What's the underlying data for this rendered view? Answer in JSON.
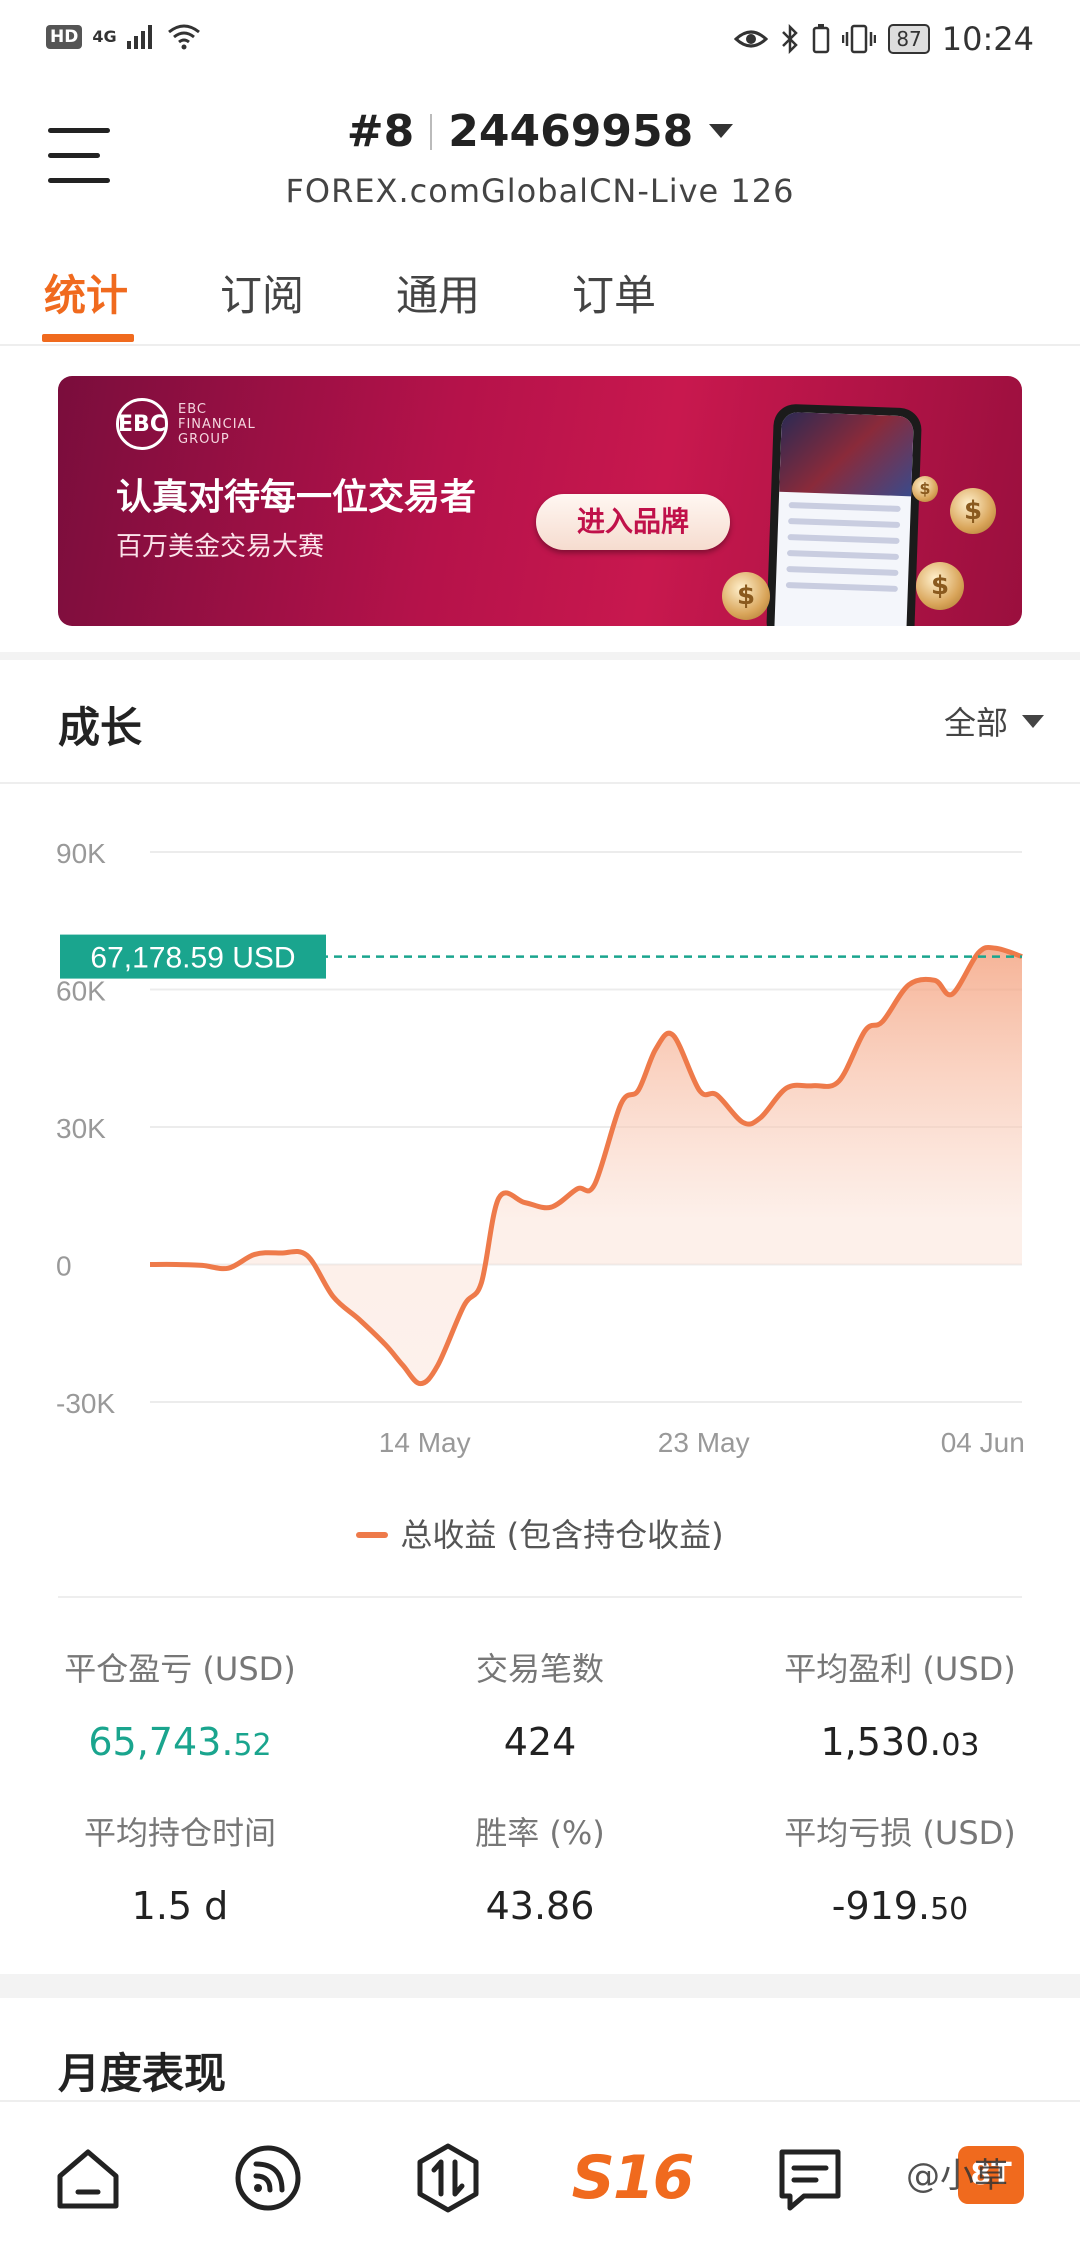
{
  "status_bar": {
    "hd": "HD",
    "network": "4G",
    "battery": "87",
    "time": "10:24"
  },
  "header": {
    "account_index": "#8",
    "account_number": "24469958",
    "server": "FOREX.comGlobalCN-Live 126"
  },
  "tabs": [
    "统计",
    "订阅",
    "通用",
    "订单"
  ],
  "banner": {
    "logo_text": "EBC",
    "logo_line1": "EBC",
    "logo_line2": "FINANCIAL",
    "logo_line3": "GROUP",
    "title": "认真对待每一位交易者",
    "subtitle": "百万美金交易大赛",
    "button": "进入品牌"
  },
  "growth": {
    "title": "成长",
    "filter": "全部",
    "current_value_label": "67,178.59 USD",
    "legend": "总收益 (包含持仓收益)"
  },
  "chart_data": {
    "type": "area",
    "title": "",
    "ylabel": "",
    "y_ticks": [
      "90K",
      "60K",
      "30K",
      "0",
      "-30K"
    ],
    "y_tick_values": [
      90000,
      60000,
      30000,
      0,
      -30000
    ],
    "ylim": [
      -30000,
      90000
    ],
    "x_tick_labels": [
      "14 May",
      "23 May",
      "04 Jun"
    ],
    "grid": true,
    "series": [
      {
        "name": "总收益 (包含持仓收益)",
        "color": "#ee7a4a",
        "points": [
          [
            0,
            0
          ],
          [
            0.03,
            0
          ],
          [
            0.06,
            -200
          ],
          [
            0.09,
            -800
          ],
          [
            0.12,
            2200
          ],
          [
            0.15,
            2500
          ],
          [
            0.18,
            2000
          ],
          [
            0.21,
            -7000
          ],
          [
            0.24,
            -12000
          ],
          [
            0.27,
            -17500
          ],
          [
            0.29,
            -22000
          ],
          [
            0.31,
            -26000
          ],
          [
            0.33,
            -22000
          ],
          [
            0.36,
            -9000
          ],
          [
            0.38,
            -4000
          ],
          [
            0.4,
            14500
          ],
          [
            0.43,
            13500
          ],
          [
            0.46,
            12500
          ],
          [
            0.49,
            16500
          ],
          [
            0.51,
            17500
          ],
          [
            0.54,
            35000
          ],
          [
            0.56,
            38000
          ],
          [
            0.58,
            47000
          ],
          [
            0.6,
            50000
          ],
          [
            0.63,
            38000
          ],
          [
            0.65,
            37000
          ],
          [
            0.68,
            31000
          ],
          [
            0.7,
            32000
          ],
          [
            0.73,
            38500
          ],
          [
            0.76,
            39000
          ],
          [
            0.79,
            40000
          ],
          [
            0.82,
            51000
          ],
          [
            0.84,
            53000
          ],
          [
            0.87,
            61000
          ],
          [
            0.9,
            62000
          ],
          [
            0.92,
            59000
          ],
          [
            0.95,
            68000
          ],
          [
            0.97,
            69000
          ],
          [
            1.0,
            67178.59
          ]
        ]
      }
    ],
    "reference_line": {
      "value": 67178.59,
      "label": "67,178.59 USD",
      "color": "#1aa58e"
    }
  },
  "stats": [
    {
      "label": "平仓盈亏 (USD)",
      "int": "65,743.",
      "frac": "52",
      "color": "green"
    },
    {
      "label": "交易笔数",
      "int": "424",
      "frac": "",
      "color": "default"
    },
    {
      "label": "平均盈利 (USD)",
      "int": "1,530.",
      "frac": "03",
      "color": "default"
    },
    {
      "label": "平均持仓时间",
      "int": "1.5 d",
      "frac": "",
      "color": "default"
    },
    {
      "label": "胜率 (%)",
      "int": "43.86",
      "frac": "",
      "color": "default"
    },
    {
      "label": "平均亏损 (USD)",
      "int": "-919.",
      "frac": "50",
      "color": "default"
    }
  ],
  "monthly": {
    "title": "月度表现"
  },
  "bottom_nav": {
    "s16_label": "S16",
    "badge": "8T",
    "watermark": "@小草"
  },
  "icons": {
    "home": "home-icon",
    "feed": "feed-icon",
    "trade": "trade-icon",
    "message": "message-icon"
  }
}
